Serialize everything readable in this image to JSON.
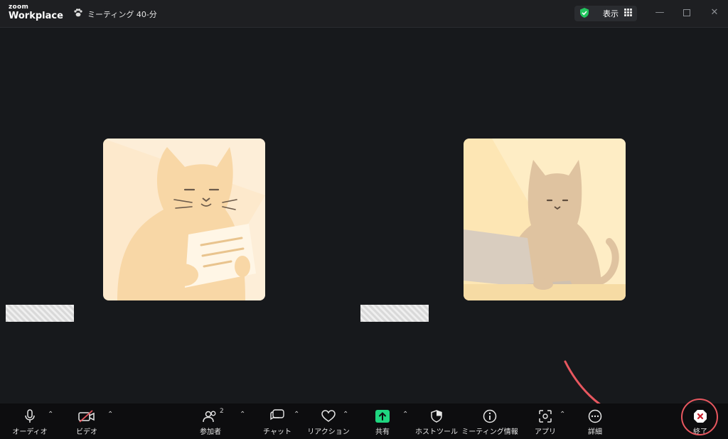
{
  "titlebar": {
    "logo_small": "zoom",
    "logo_big": "Workplace",
    "meeting_title": "ミーティング 40-分",
    "view_label": "表示"
  },
  "toolbar": {
    "audio": "オーディオ",
    "video": "ビデオ",
    "participants": "参加者",
    "participants_count": "2",
    "chat": "チャット",
    "reactions": "リアクション",
    "share": "共有",
    "host_tools": "ホストツール",
    "meeting_info": "ミーティング情報",
    "apps": "アプリ",
    "more": "詳細",
    "end": "終了"
  },
  "colors": {
    "accent_share": "#1fd680",
    "end_highlight": "#e8575f",
    "security_shield": "#22c55e"
  },
  "icons": [
    "paw-icon",
    "shield-icon",
    "grid-icon",
    "minimize-icon",
    "maximize-icon",
    "close-icon",
    "microphone-icon",
    "video-off-icon",
    "participants-icon",
    "chat-icon",
    "heart-icon",
    "share-up-icon",
    "host-shield-icon",
    "info-icon",
    "apps-icon",
    "more-icon",
    "end-icon"
  ]
}
